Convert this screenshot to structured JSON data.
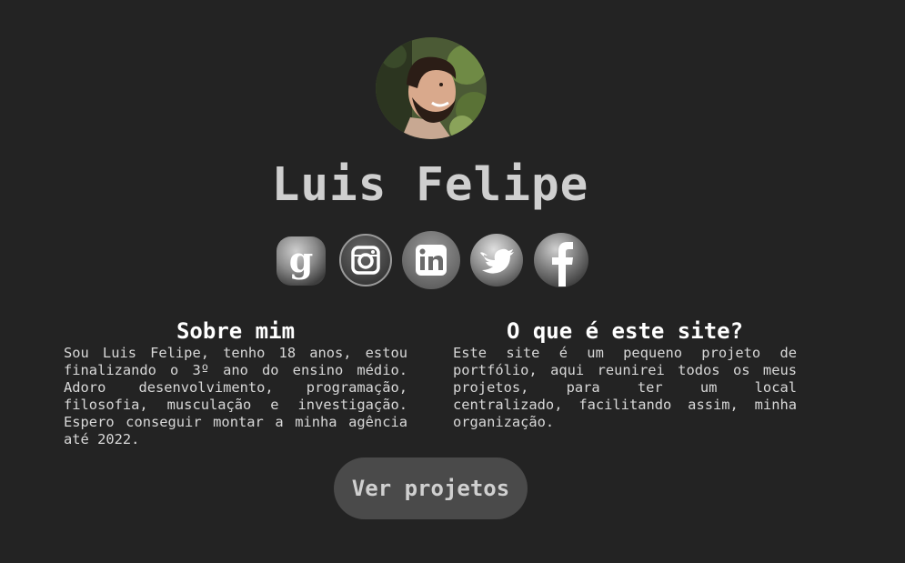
{
  "profile": {
    "name": "Luis Felipe",
    "avatar_icon": "profile-photo"
  },
  "social": [
    {
      "icon": "goodreads-icon",
      "label": "Goodreads"
    },
    {
      "icon": "instagram-icon",
      "label": "Instagram"
    },
    {
      "icon": "linkedin-icon",
      "label": "LinkedIn"
    },
    {
      "icon": "twitter-icon",
      "label": "Twitter"
    },
    {
      "icon": "facebook-icon",
      "label": "Facebook"
    }
  ],
  "about": {
    "title": "Sobre mim",
    "text": "Sou Luis Felipe, tenho 18 anos, estou finalizando o 3º ano do ensino médio. Adoro desenvolvimento, programação, filosofia, musculação e investigação. Espero conseguir montar a minha agência até 2022."
  },
  "site": {
    "title": "O que é este site?",
    "text": "Este site é um pequeno projeto de portfólio, aqui reunirei todos os meus projetos, para ter um local centralizado, facilitando assim, minha organização."
  },
  "cta": {
    "label": "Ver projetos"
  },
  "colors": {
    "background": "#232323",
    "button": "#4a4a4a",
    "title_text": "#cfcfcf"
  }
}
